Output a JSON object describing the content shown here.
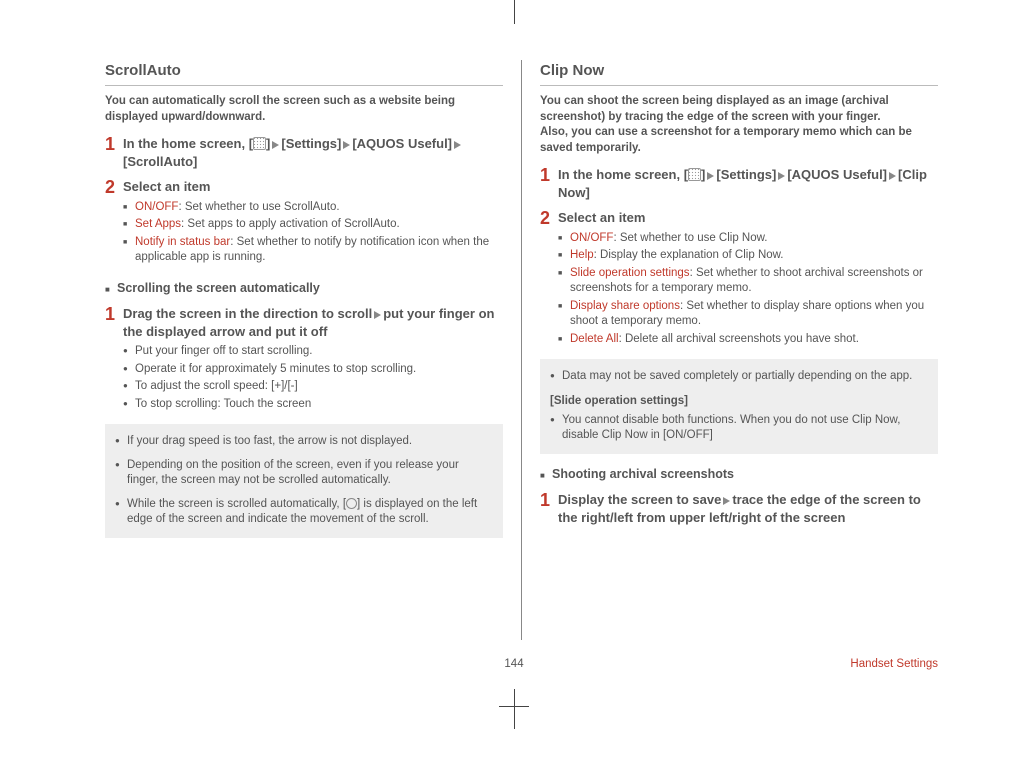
{
  "page_number": "144",
  "footer_label": "Handset Settings",
  "left": {
    "title": "ScrollAuto",
    "intro": "You can automatically scroll the screen such as a website being displayed upward/downward.",
    "steps": [
      {
        "num": "1",
        "parts": [
          "In the home screen, [",
          "]",
          "[Settings]",
          "[AQUOS Useful]",
          "[ScrollAuto]"
        ]
      },
      {
        "num": "2",
        "head": "Select an item",
        "items": [
          {
            "label": "ON/OFF",
            "text": ": Set whether to use ScrollAuto."
          },
          {
            "label": "Set Apps",
            "text": ": Set apps to apply activation of ScrollAuto."
          },
          {
            "label": "Notify in status bar",
            "text": ": Set whether to notify by notification icon when the applicable app is running."
          }
        ]
      }
    ],
    "sub_heading": "Scrolling the screen automatically",
    "sub_step": {
      "num": "1",
      "parts": [
        "Drag the screen in the direction to scroll",
        "put your finger on the displayed arrow and put it off"
      ],
      "bullets": [
        "Put your finger off to start scrolling.",
        "Operate it for approximately 5 minutes to stop scrolling.",
        "To adjust the scroll speed: [+]/[-]",
        "To stop scrolling: Touch the screen"
      ]
    },
    "notes": [
      "If your drag speed is too fast, the arrow is not displayed.",
      "Depending on the position of the screen, even if you release your finger, the screen may not be scrolled automatically.",
      {
        "pre": "While the screen is scrolled automatically, [",
        "post": "] is displayed on the left edge of the screen and indicate the movement of the scroll."
      }
    ]
  },
  "right": {
    "title": "Clip Now",
    "intro": "You can shoot the screen being displayed as an image (archival screenshot) by tracing the edge of the screen with your finger.\nAlso, you can use a screenshot for a temporary memo which can be saved temporarily.",
    "steps": [
      {
        "num": "1",
        "parts": [
          "In the home screen, [",
          "]",
          "[Settings]",
          "[AQUOS Useful]",
          "[Clip Now]"
        ]
      },
      {
        "num": "2",
        "head": "Select an item",
        "items": [
          {
            "label": "ON/OFF",
            "text": ": Set whether to use Clip Now."
          },
          {
            "label": "Help",
            "text": ": Display the explanation of Clip Now."
          },
          {
            "label": "Slide operation settings",
            "text": ": Set whether to shoot archival screenshots or screenshots for a temporary memo."
          },
          {
            "label": "Display share options",
            "text": ": Set whether to display share options when you shoot a temporary memo."
          },
          {
            "label": "Delete All",
            "text": ": Delete all archival screenshots you have shot."
          }
        ]
      }
    ],
    "notes": [
      "Data may not be saved completely or partially depending on the app."
    ],
    "note_sub_head": "[Slide operation settings]",
    "notes2": [
      "You cannot disable both functions. When you do not use Clip Now, disable Clip Now in [ON/OFF]"
    ],
    "sub_heading": "Shooting archival screenshots",
    "sub_step": {
      "num": "1",
      "parts": [
        "Display the screen to save",
        "trace the edge of the screen to the right/left from upper left/right of the screen"
      ]
    }
  }
}
